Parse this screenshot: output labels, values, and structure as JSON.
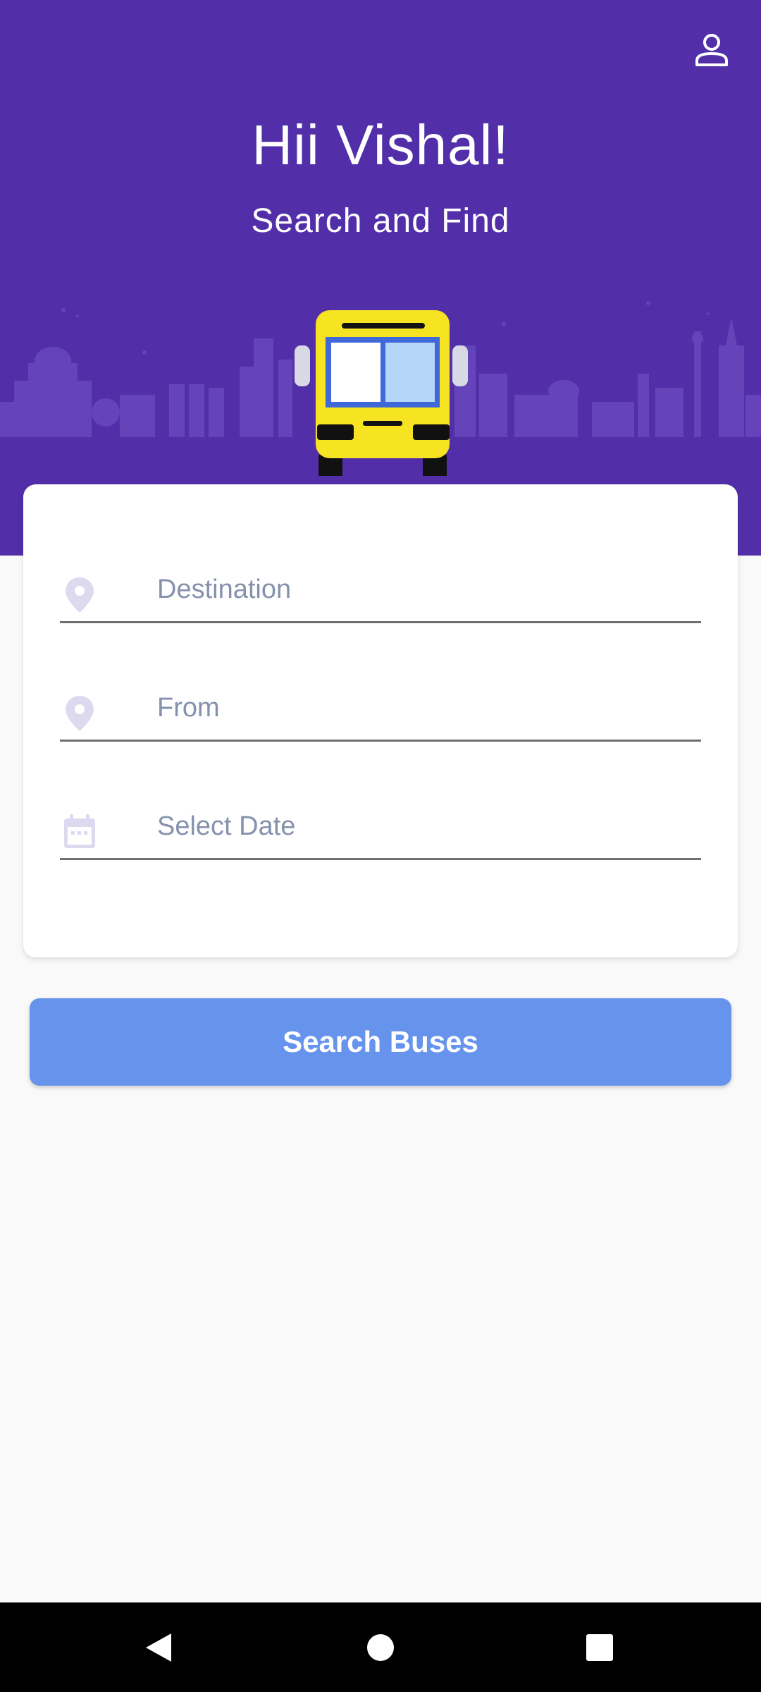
{
  "header": {
    "greeting": "Hii Vishal!",
    "subtitle": "Search and Find",
    "background_color": "#522fa9"
  },
  "icons": {
    "profile": "person-icon",
    "location": "location-pin-icon",
    "calendar": "calendar-icon",
    "bus": "bus-illustration"
  },
  "form": {
    "destination_placeholder": "Destination",
    "from_placeholder": "From",
    "date_placeholder": "Select Date"
  },
  "search_button": {
    "label": "Search Buses",
    "color": "#6694ec"
  },
  "navbar": {
    "back": "back-icon",
    "home": "home-icon",
    "recents": "recents-icon"
  }
}
